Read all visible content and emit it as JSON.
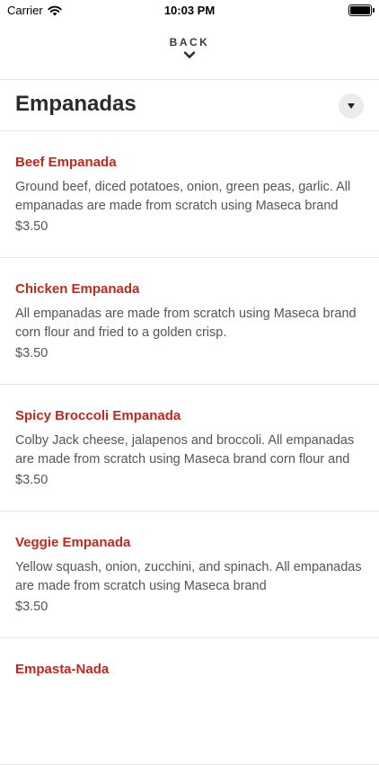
{
  "status_bar": {
    "carrier": "Carrier",
    "time": "10:03 PM"
  },
  "nav": {
    "back_label": "BACK"
  },
  "section": {
    "title": "Empanadas"
  },
  "colors": {
    "item_name": "#c0281f",
    "text_secondary": "#555555",
    "divider": "#e6e6e6"
  },
  "items": [
    {
      "name": "Beef Empanada",
      "description": "Ground beef, diced potatoes, onion, green peas, garlic. All empanadas are made from scratch using Maseca brand",
      "price": "$3.50"
    },
    {
      "name": "Chicken Empanada",
      "description": "All empanadas are made from scratch using Maseca brand corn flour and fried to a golden crisp.",
      "price": "$3.50"
    },
    {
      "name": "Spicy Broccoli Empanada",
      "description": "Colby Jack cheese, jalapenos and broccoli. All empanadas are made from scratch using Maseca brand corn flour and",
      "price": "$3.50"
    },
    {
      "name": "Veggie Empanada",
      "description": "Yellow squash, onion, zucchini, and spinach. All empanadas are made from scratch using Maseca brand",
      "price": "$3.50"
    },
    {
      "name": "Empasta-Nada",
      "description": "",
      "price": ""
    }
  ]
}
